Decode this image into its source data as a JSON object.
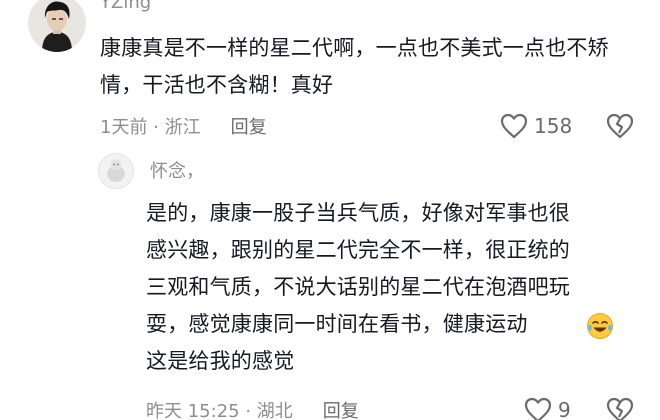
{
  "comments": {
    "main": {
      "username": "YZing",
      "text": "康康真是不一样的星二代啊，一点也不美式一点也不矫情，干活也不含糊！真好",
      "time_location": "1天前 · 浙江",
      "reply_label": "回复",
      "like_count": "158"
    },
    "reply": {
      "username": "怀念，",
      "lines": [
        "是的，康康一股子当兵气质，好像对军事也很",
        "感兴趣，跟别的星二代完全不一样，很正统的",
        "三观和气质，不说大话别的星二代在泡酒吧玩",
        "耍，感觉康康同一时间在看书，健康运动",
        "这是给我的感觉"
      ],
      "emoji": "laughing-crying-emoji",
      "time_location": "昨天 15:25 · 湖北",
      "reply_label": "回复",
      "like_count": "9"
    }
  },
  "colors": {
    "text": "#161823",
    "meta": "#8e8e8e",
    "action": "#6b6b6b"
  }
}
